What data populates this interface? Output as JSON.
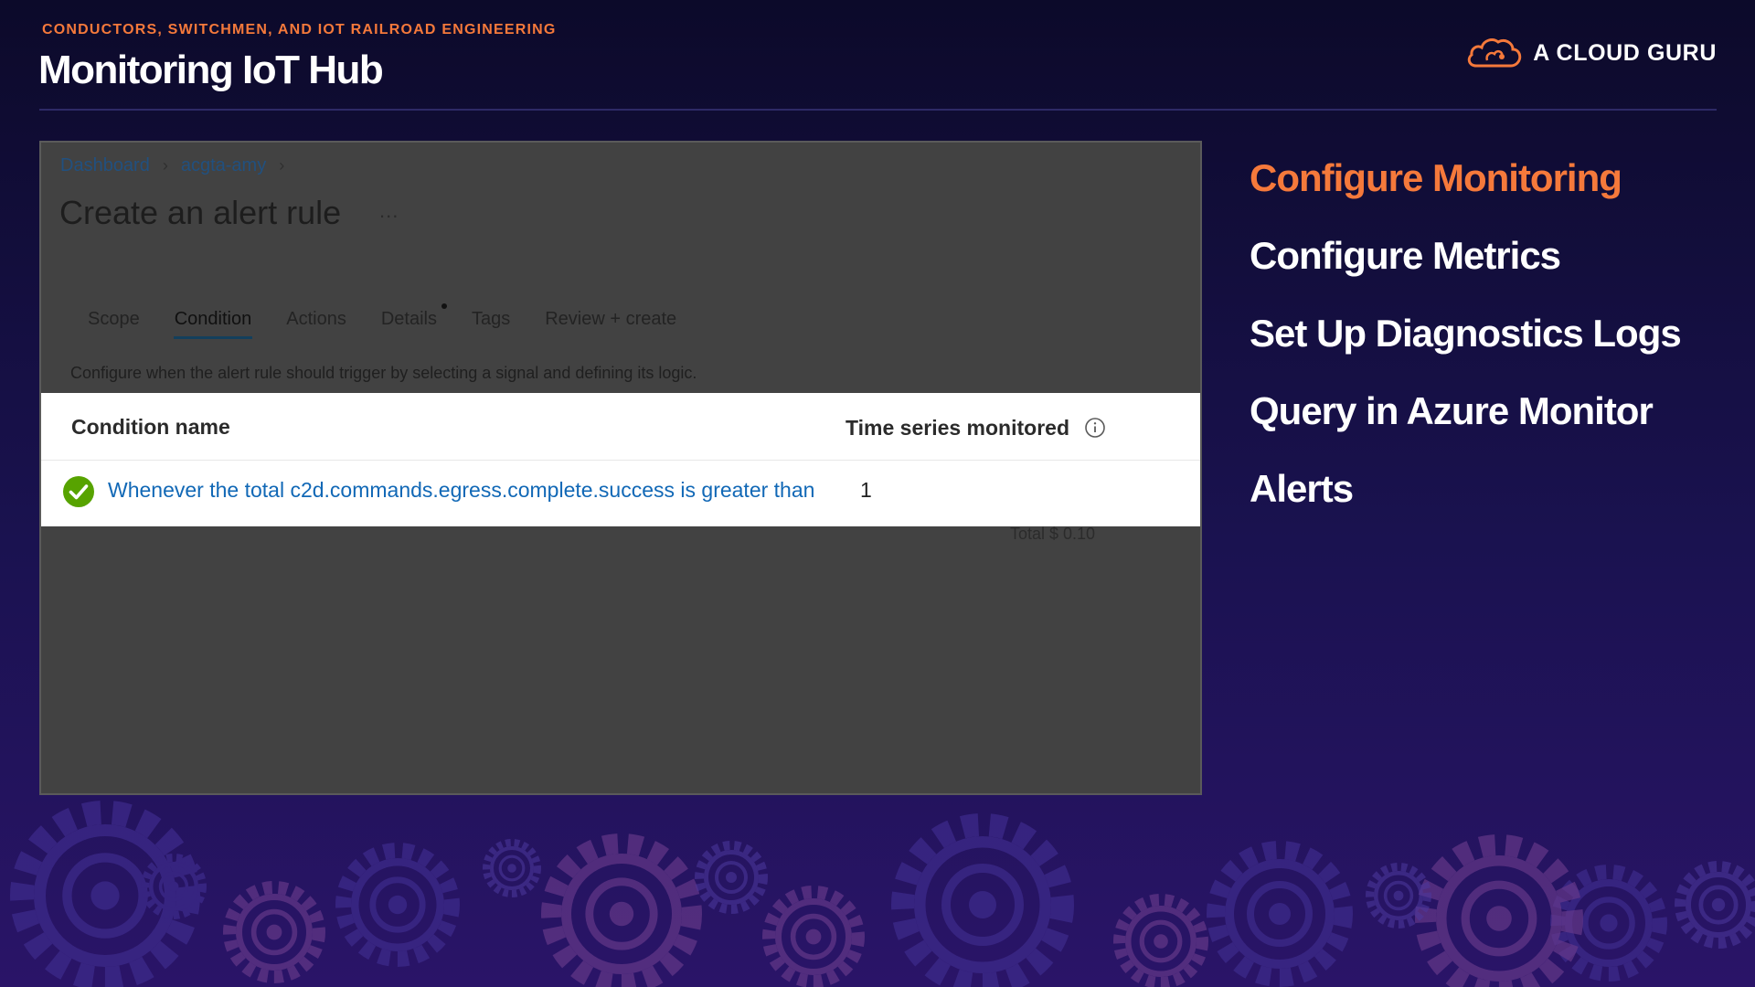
{
  "header": {
    "eyebrow": "CONDUCTORS, SWITCHMEN, AND IOT RAILROAD ENGINEERING",
    "title": "Monitoring IoT Hub",
    "brand": "A CLOUD GURU"
  },
  "portal": {
    "breadcrumb": [
      "Dashboard",
      "acgta-amy"
    ],
    "title": "Create an alert rule",
    "more": "...",
    "tabs": [
      "Scope",
      "Condition",
      "Actions",
      "Details",
      "Tags",
      "Review + create"
    ],
    "active_tab": "Condition",
    "description": "Configure when the alert rule should trigger by selecting a signal and defining its logic.",
    "table": {
      "col_name": "Condition name",
      "col_series": "Time series monitored",
      "row": {
        "condition": "Whenever the total c2d.commands.egress.complete.success is greater than",
        "series_count": "1"
      }
    },
    "ghost_text": "Total $ 0.10"
  },
  "topics": [
    "Configure Monitoring",
    "Configure Metrics",
    "Set Up Diagnostics Logs",
    "Query in Azure Monitor",
    "Alerts"
  ],
  "colors": {
    "accent": "#f5793b",
    "link": "#1168b6",
    "success": "#57a300",
    "background": "#1a1250"
  }
}
